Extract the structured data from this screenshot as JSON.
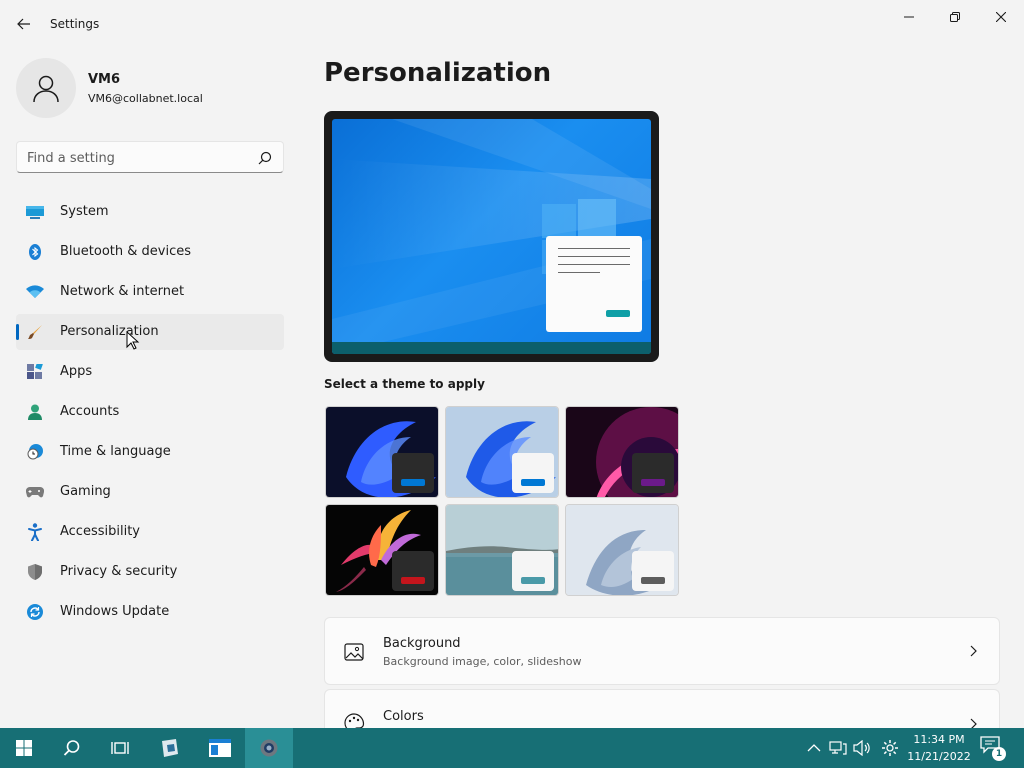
{
  "window": {
    "title": "Settings",
    "controls": [
      "minimize",
      "restore",
      "close"
    ]
  },
  "user": {
    "name": "VM6",
    "email": "VM6@collabnet.local"
  },
  "search": {
    "placeholder": "Find a setting"
  },
  "sidebar": {
    "items": [
      {
        "label": "System",
        "icon": "monitor-icon"
      },
      {
        "label": "Bluetooth & devices",
        "icon": "bluetooth-icon"
      },
      {
        "label": "Network & internet",
        "icon": "wifi-icon"
      },
      {
        "label": "Personalization",
        "icon": "paintbrush-icon",
        "active": true
      },
      {
        "label": "Apps",
        "icon": "apps-icon"
      },
      {
        "label": "Accounts",
        "icon": "person-icon"
      },
      {
        "label": "Time & language",
        "icon": "clock-globe-icon"
      },
      {
        "label": "Gaming",
        "icon": "gamepad-icon"
      },
      {
        "label": "Accessibility",
        "icon": "accessibility-icon"
      },
      {
        "label": "Privacy & security",
        "icon": "shield-icon"
      },
      {
        "label": "Windows Update",
        "icon": "update-icon"
      }
    ]
  },
  "main": {
    "title": "Personalization",
    "themes_label": "Select a theme to apply",
    "themes": [
      {
        "name": "windows-dark",
        "accent": "#0078d4",
        "badge": "#2b2b2b"
      },
      {
        "name": "windows-light",
        "accent": "#0078d4",
        "badge": "#f5f5f5"
      },
      {
        "name": "glow",
        "accent": "#6b1a8a",
        "badge": "#2b2b2b"
      },
      {
        "name": "captured-motion",
        "accent": "#c4151c",
        "badge": "#2b2b2b"
      },
      {
        "name": "sunrise",
        "accent": "#4a9aa8",
        "badge": "#f5f5f5"
      },
      {
        "name": "flow",
        "accent": "#5d5d5d",
        "badge": "#f5f5f5"
      }
    ],
    "cards": [
      {
        "title": "Background",
        "subtitle": "Background image, color, slideshow",
        "icon": "image-icon"
      },
      {
        "title": "Colors",
        "subtitle": "",
        "icon": "palette-icon"
      }
    ]
  },
  "taskbar": {
    "time": "11:34 PM",
    "date": "11/21/2022",
    "notification_count": "1",
    "accent": "#176f75"
  }
}
